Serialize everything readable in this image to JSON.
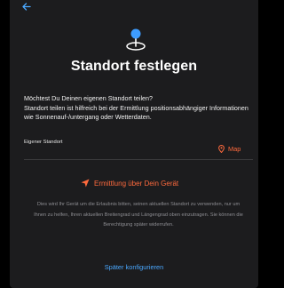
{
  "header": {
    "back_icon": "arrow-left-icon"
  },
  "hero": {
    "icon": "location-pin-icon",
    "title": "Standort festlegen"
  },
  "description": {
    "line1": "Möchtest Du Deinen eigenen Standort teilen?",
    "line2": "Standort teilen ist hilfreich bei der Ermittlung positionsabhängiger Informationen wie Sonnenauf-/untergang oder Wetterdaten."
  },
  "location_field": {
    "label": "Eigener Standort",
    "map_label": "Map",
    "map_icon": "map-pin-icon"
  },
  "locate": {
    "label": "Ermittlung über Dein Gerät",
    "icon": "navigation-arrow-icon"
  },
  "info_text": "Dies wird Ihr Gerät um die Erlaubnis bitten, seinen aktuellen Standort zu verwenden, nur um Ihnen zu helfen, Ihren aktuellen Breitengrad und Längengrad oben einzutragen. Sie können die Berechtigung später widerrufen.",
  "later_button": "Später konfigurieren",
  "colors": {
    "background": "#000000",
    "sheet": "#1c1c1e",
    "accent_orange": "#ff6a3d",
    "link_blue": "#4aa8ff",
    "icon_blue": "#3d9cff"
  }
}
